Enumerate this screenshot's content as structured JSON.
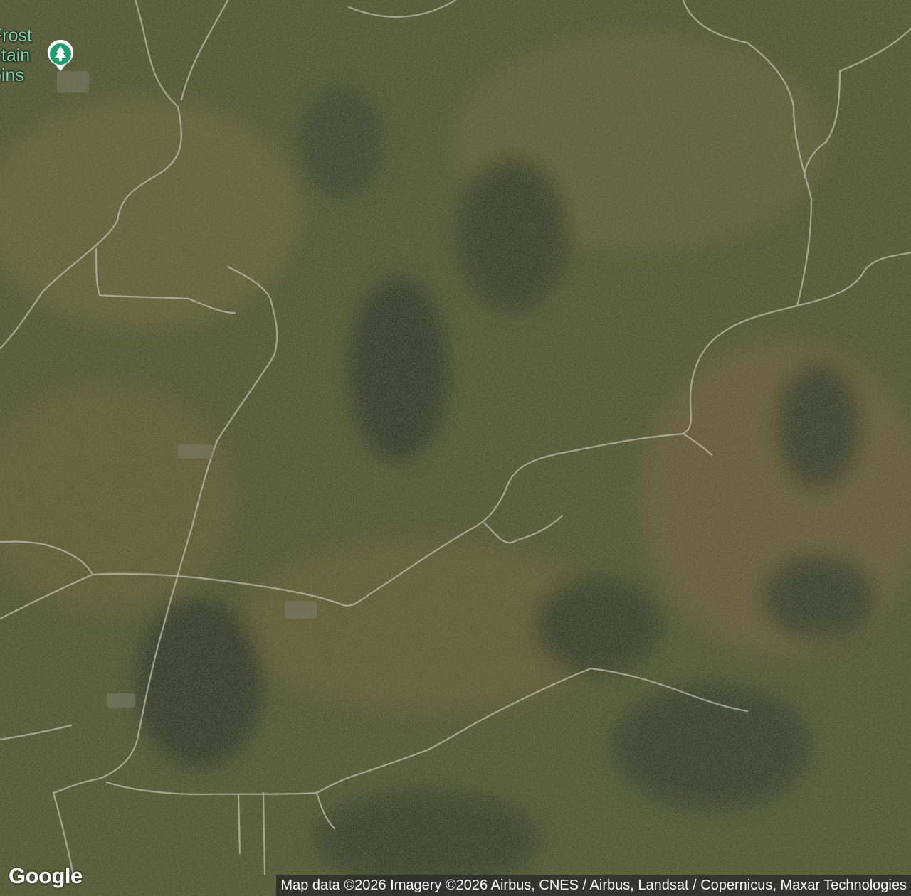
{
  "map": {
    "type": "satellite",
    "colors": {
      "forest_dark": "#253020",
      "forest_mid": "#4a5230",
      "forest_autumn": "#6b5a2e",
      "road": "#b9b6a6"
    }
  },
  "poi": {
    "label": "Frost\nntain\nbins",
    "icon": "tree-icon",
    "color": "#1e9e6e"
  },
  "branding": {
    "logo": "Google"
  },
  "attribution": {
    "text": "Map data ©2026 Imagery ©2026 Airbus, CNES / Airbus, Landsat / Copernicus, Maxar Technologies"
  }
}
